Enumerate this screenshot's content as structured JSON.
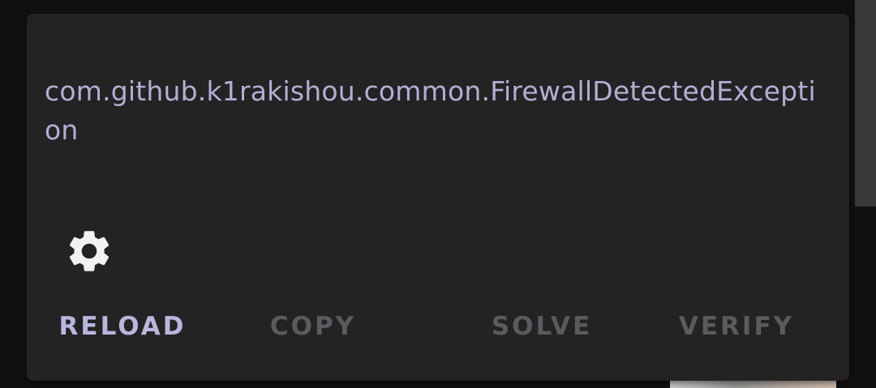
{
  "dialog": {
    "message": "com.github.k1rakishou.common.FirewallDetectedException",
    "settings_icon": "gear-icon",
    "actions": {
      "reload": "RELOAD",
      "copy": "COPY",
      "solve": "SOLVE",
      "verify": "VERIFY"
    }
  },
  "colors": {
    "dialog_background": "#232323",
    "message_text": "#b2afd6",
    "enabled_action": "#b9b7de",
    "disabled_action": "#5b5b5f"
  }
}
